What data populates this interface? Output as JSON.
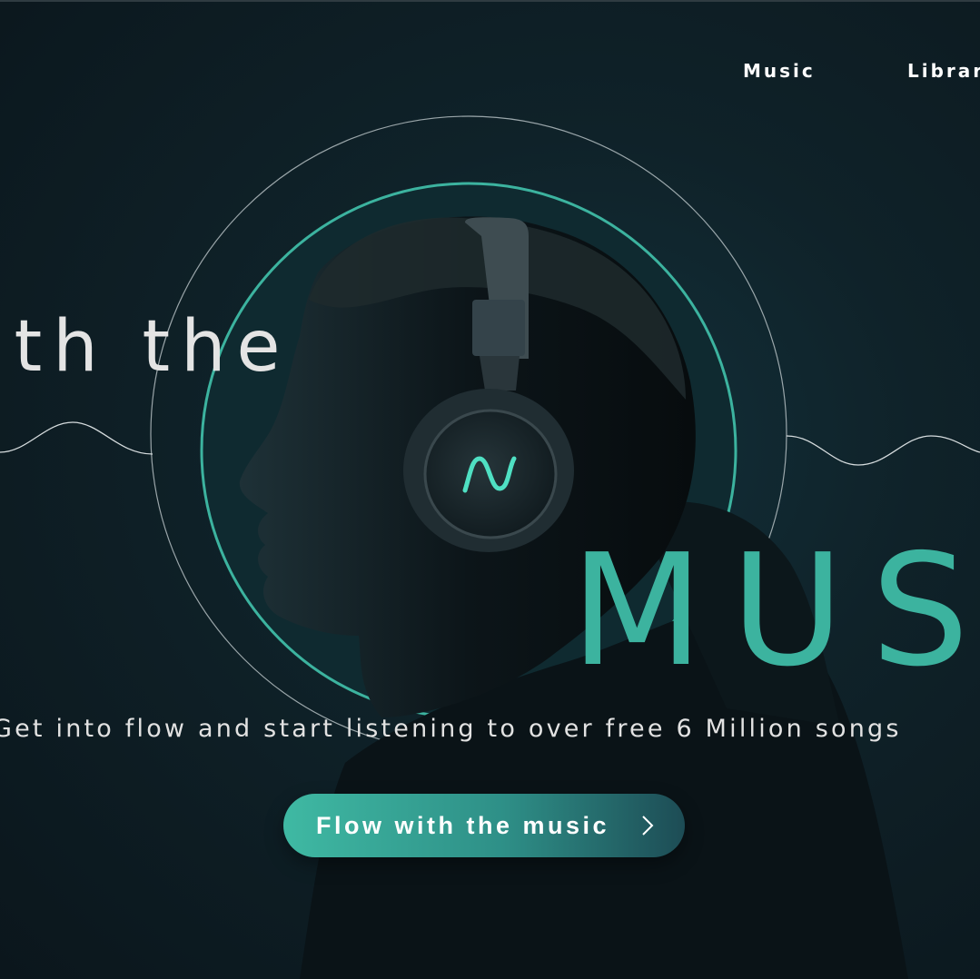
{
  "nav": {
    "items": [
      {
        "label": "Music"
      },
      {
        "label": "Librar"
      }
    ]
  },
  "hero": {
    "headline_small": "ith the",
    "headline_big": "MUS",
    "tagline": "Get into flow and start listening to over free 6 Million songs",
    "cta_label": "Flow with the music",
    "cta_icon": "chevron-right-icon"
  },
  "colors": {
    "accent": "#3cb39f",
    "background": "#0e1b22",
    "text": "#e4e4e4"
  }
}
